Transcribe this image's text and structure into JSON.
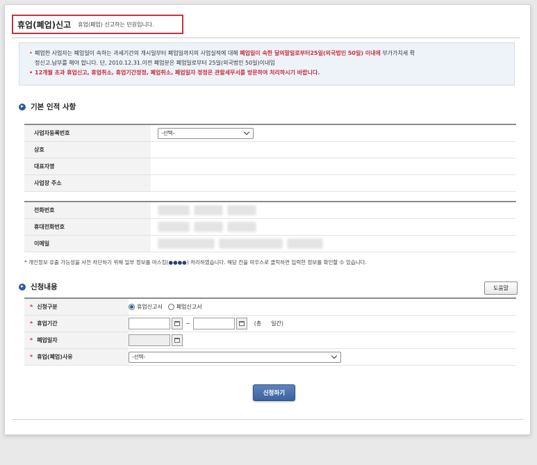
{
  "header": {
    "title": "휴업(폐업)신고",
    "subtitle": "휴업(폐업) 신고하는 민원입니다."
  },
  "notice": {
    "line1_prefix": "폐업한 사업자는 폐업일이 속하는 과세기간의 개시일부터 폐업일까지의 사업실적에 대해 ",
    "line1_highlight": "폐업일이 속한 달의말일로부터25일(외국법인 50일) 이내에",
    "line1_suffix": " 부가가치세 확",
    "line2": "정신고.납부를 해야 합니다. 단, 2010.12.31.이전 폐업분은 폐업일로부터 25일(외국법인 50일)이내임",
    "line3": "12개월 초과 휴업신고, 휴업취소, 휴업기간정정, 폐업취소, 폐업일자 정정은 관할세무서를 방문하여 처리하시기 바랍니다."
  },
  "basic_info": {
    "heading": "기본 인적 사항",
    "rows": [
      {
        "label": "사업자등록번호",
        "value": "-선택-"
      },
      {
        "label": "상호",
        "value": ""
      },
      {
        "label": "대표자명",
        "value": ""
      },
      {
        "label": "사업장 주소",
        "value": ""
      }
    ],
    "contact_rows": [
      {
        "label": "전화번호"
      },
      {
        "label": "휴대전화번호"
      },
      {
        "label": "이메일"
      }
    ]
  },
  "privacy_note": {
    "prefix": "* 개인정보 유출 가능성을 사전 차단하기 위해 일부 정보를 마스킹(",
    "dots": "●●●●",
    "suffix": ") 처리하였습니다. 해당 칸을 마우스로 클릭하면 입력한 정보를 확인할 수 있습니다."
  },
  "application": {
    "heading": "신청내용",
    "help_label": "도움말",
    "type_label": "신청구분",
    "option_suspend": "휴업신고서",
    "option_close": "폐업신고서",
    "period_label": "휴업기간",
    "period_sep": "~",
    "period_total_prefix": "(총",
    "period_total_suffix": "일간)",
    "close_date_label": "폐업일자",
    "reason_label": "휴업(폐업)사유",
    "reason_value": "-선택-",
    "required_mark": "*"
  },
  "submit_label": "신청하기"
}
